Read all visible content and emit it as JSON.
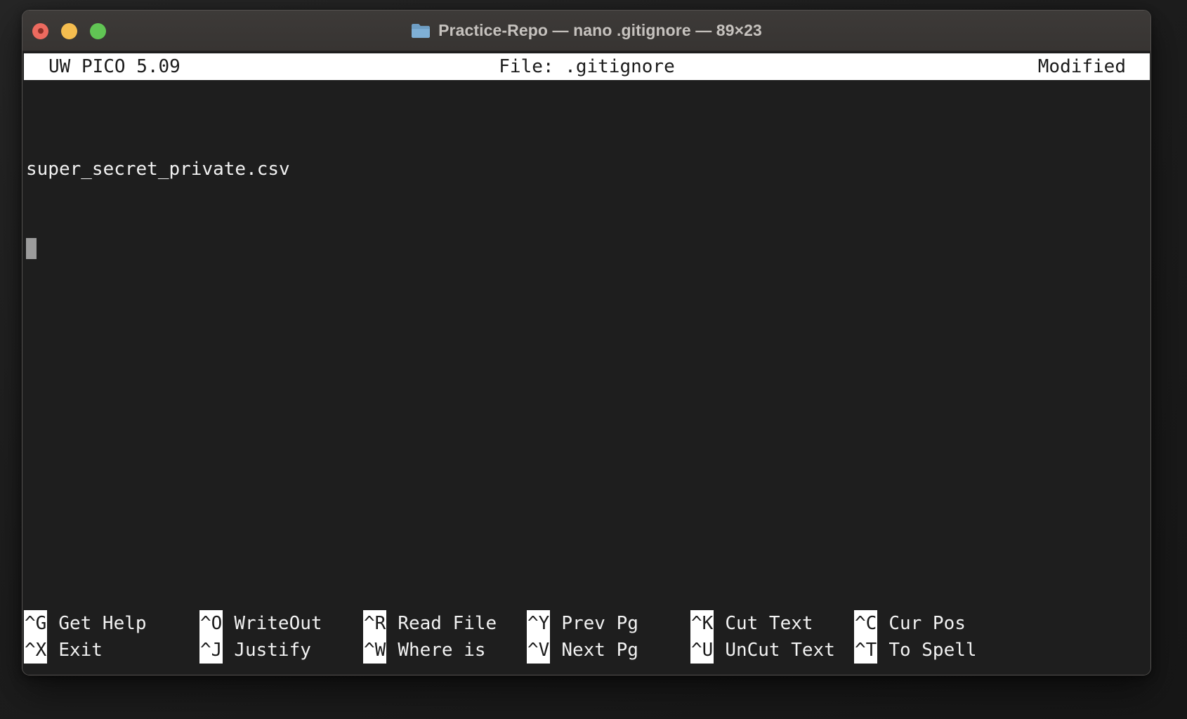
{
  "window": {
    "title": "Practice-Repo — nano .gitignore — 89×23",
    "folder_icon": "folder-icon",
    "traffic_lights": [
      {
        "name": "close",
        "color": "#ec6a5f"
      },
      {
        "name": "minimize",
        "color": "#f5bd4f"
      },
      {
        "name": "maximize",
        "color": "#61c554"
      }
    ]
  },
  "nano": {
    "version": "UW PICO 5.09",
    "file_label": "File: .gitignore",
    "status": "Modified",
    "content_lines": [
      "super_secret_private.csv"
    ],
    "cursor": {
      "line": 2,
      "column": 1
    },
    "shortcuts_row1": [
      {
        "key": "^G",
        "label": "Get Help"
      },
      {
        "key": "^O",
        "label": "WriteOut"
      },
      {
        "key": "^R",
        "label": "Read File"
      },
      {
        "key": "^Y",
        "label": "Prev Pg"
      },
      {
        "key": "^K",
        "label": "Cut Text"
      },
      {
        "key": "^C",
        "label": "Cur Pos"
      }
    ],
    "shortcuts_row2": [
      {
        "key": "^X",
        "label": "Exit"
      },
      {
        "key": "^J",
        "label": "Justify"
      },
      {
        "key": "^W",
        "label": "Where is"
      },
      {
        "key": "^V",
        "label": "Next Pg"
      },
      {
        "key": "^U",
        "label": "UnCut Text"
      },
      {
        "key": "^T",
        "label": "To Spell"
      }
    ]
  },
  "colors": {
    "terminal_background": "#1e1e1e",
    "terminal_foreground": "#f2f2f2",
    "titlebar_background": "#3a3735",
    "inverse_background": "#ffffff",
    "inverse_foreground": "#1b1b1b",
    "cursor": "#9c9c9c"
  }
}
